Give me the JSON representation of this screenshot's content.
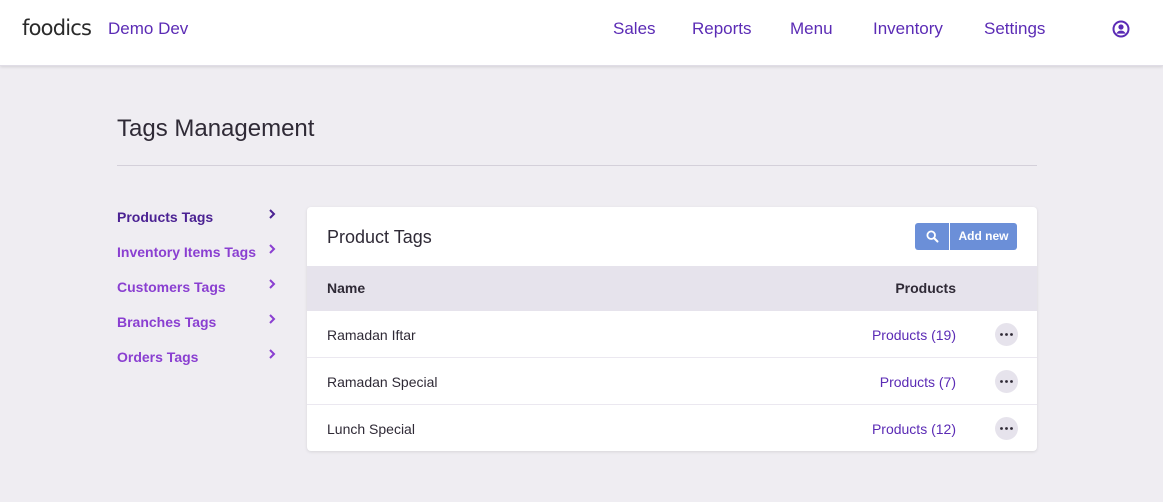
{
  "header": {
    "logo": "foodics",
    "business_name": "Demo Dev",
    "nav": {
      "sales": "Sales",
      "reports": "Reports",
      "menu": "Menu",
      "inventory": "Inventory",
      "settings": "Settings"
    },
    "user_icon": "user-circle-icon"
  },
  "page": {
    "title": "Tags Management"
  },
  "sidebar": {
    "items": [
      {
        "label": "Products Tags",
        "active": true
      },
      {
        "label": "Inventory Items Tags",
        "active": false
      },
      {
        "label": "Customers Tags",
        "active": false
      },
      {
        "label": "Branches Tags",
        "active": false
      },
      {
        "label": "Orders Tags",
        "active": false
      }
    ]
  },
  "card": {
    "title": "Product Tags",
    "search_icon": "search-icon",
    "add_label": "Add new",
    "columns": {
      "name": "Name",
      "products": "Products"
    },
    "rows": [
      {
        "name": "Ramadan Iftar",
        "products": "Products (19)"
      },
      {
        "name": "Ramadan Special",
        "products": "Products (7)"
      },
      {
        "name": "Lunch Special",
        "products": "Products (12)"
      }
    ]
  },
  "colors": {
    "accent": "#5b2bb5",
    "sidebar_link": "#8a3fd1",
    "button": "#6b8fd8",
    "background": "#efedf2"
  }
}
